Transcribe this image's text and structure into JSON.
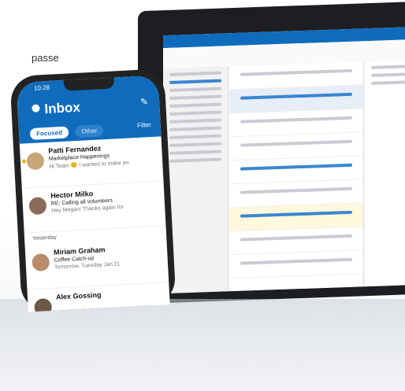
{
  "caption": "passe",
  "phone": {
    "time": "10:28",
    "title": "Inbox",
    "tabs": [
      "Focused",
      "Other"
    ],
    "filter_label": "Filter",
    "section_label": "Yesterday",
    "messages": [
      {
        "sender": "Patti Fernandez",
        "subject": "Marketplace Happenings",
        "preview": "Hi Team 😊 I wanted to make an"
      },
      {
        "sender": "Hector Milko",
        "subject": "RE: Calling all volunteers",
        "preview": "Hey Megan! Thanks again for"
      },
      {
        "sender": "Miriam Graham",
        "subject": "Coffee Catch-up",
        "preview": "Tomorrow, Tuesday Jan 21"
      },
      {
        "sender": "Alex Gossing",
        "subject": "",
        "preview": ""
      }
    ]
  },
  "laptop": {
    "folder_count": 14,
    "message_rows": 9
  }
}
